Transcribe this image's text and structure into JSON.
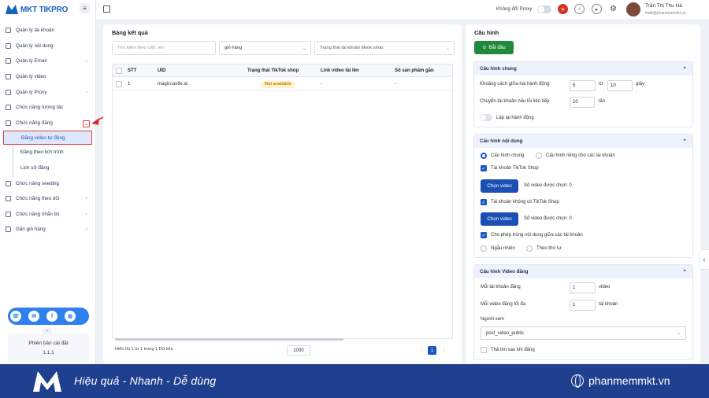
{
  "app": {
    "logo_text": "MKT TIKPRO"
  },
  "sidebar": {
    "items": [
      {
        "label": "Quản lý tài khoản",
        "chevron": false
      },
      {
        "label": "Quản lý nội dung",
        "chevron": false
      },
      {
        "label": "Quản lý Email",
        "chevron": true
      },
      {
        "label": "Quản lý video",
        "chevron": false
      },
      {
        "label": "Quản lý Proxy",
        "chevron": true
      },
      {
        "label": "Chức năng tương tác",
        "chevron": false
      },
      {
        "label": "Chức năng đăng",
        "chevron": true
      }
    ],
    "subitems": [
      "Đăng video tự động",
      "Đăng theo lịch trình",
      "Lịch sử đăng"
    ],
    "items2": [
      {
        "label": "Chức năng seeding",
        "chevron": false
      },
      {
        "label": "Chức năng theo dõi",
        "chevron": true
      },
      {
        "label": "Chức năng nhắn tin",
        "chevron": true
      },
      {
        "label": "Gắn giỏ hàng",
        "chevron": true
      }
    ],
    "version_label": "Phiên bản cài đặt",
    "version_number": "1.1.1"
  },
  "topbar": {
    "proxy_label": "Không đổi Proxy",
    "user_name": "Trần Thị Thu Hà",
    "user_email": "hattt@phanmemmkt.vn"
  },
  "results": {
    "title": "Bảng kết quả",
    "search_placeholder": "Tìm kiếm theo UID, tên",
    "filter1": "giỏ hàng",
    "filter2": "Trạng thái tài khoản tiktok shop",
    "columns": [
      "STT",
      "UID",
      "Trạng thái TikTok shop",
      "Link video tải lên",
      "Số sản phẩm gắn"
    ],
    "rows": [
      {
        "stt": "1",
        "uid": "magiccastle.ai",
        "status": "Not available",
        "link": "-",
        "count": "-"
      }
    ],
    "footer": "Hiển thị 1 từ 1 trong 1 Dữ liệu",
    "page_size": "1000",
    "page": "1"
  },
  "config": {
    "title": "Cấu hình",
    "start_label": "Bắt đầu",
    "general": {
      "title": "Cấu hình chung",
      "delay_label": "Khoảng cách giữa hai hành động",
      "delay_from": "5",
      "delay_to_label": "từ",
      "delay_to": "10",
      "delay_unit": "giây",
      "switch_label": "Chuyển tài khoản nếu lỗi liên tiếp",
      "switch_value": "10",
      "switch_unit": "lần",
      "repeat_label": "Lặp lại hành động"
    },
    "content": {
      "title": "Cấu hình nội dung",
      "opt_general": "Cấu hình chung",
      "opt_separate": "Cấu hình riêng cho các tài khoản",
      "shop_account": "Tài khoản TikTok Shop",
      "choose_video": "Chọn video",
      "selected1": "Số video được chọn: 0",
      "no_shop_account": "Tài khoản không có TikTok Shop",
      "selected2": "Số video được chọn: 0",
      "allow_dup": "Cho phép trùng nội dung giữa các tài khoản",
      "random": "Ngẫu nhiên",
      "sequential": "Theo thứ tự"
    },
    "video": {
      "title": "Cấu hình Video đăng",
      "per_account_label": "Mỗi tài khoản đăng",
      "per_account_value": "1",
      "per_account_unit": "video",
      "max_label": "Mỗi video đăng tối đa",
      "max_value": "1",
      "max_unit": "tài khoản",
      "viewer_label": "Người xem",
      "viewer_value": "post_video_public",
      "heart_label": "Thả tim sau khi đăng"
    }
  },
  "banner": {
    "slogan": "Hiệu quả - Nhanh - Dễ dùng",
    "site": "phanmemmkt.vn"
  },
  "colors": {
    "primary": "#1a55c4",
    "start": "#1f8a3b",
    "banner": "#1f3f8f",
    "highlight": "#e23b3b"
  }
}
